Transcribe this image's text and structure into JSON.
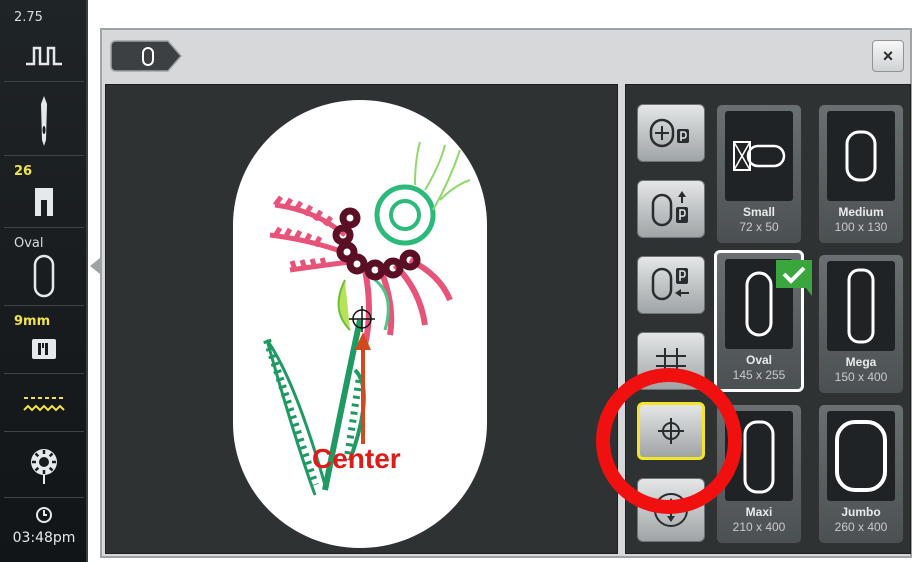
{
  "sidebar": {
    "stitch_width": "2.75",
    "thread_tension": "26",
    "hoop_label": "Oval",
    "stitch_length": "9mm",
    "clock": "03:48pm"
  },
  "top_tab": {
    "icon": "hoop-oval-icon"
  },
  "close_button": {
    "label": "×"
  },
  "tools": [
    {
      "icon": "move-to-park-icon"
    },
    {
      "icon": "move-up-park-icon"
    },
    {
      "icon": "move-left-park-icon"
    },
    {
      "icon": "grid-icon"
    },
    {
      "icon": "crosshair-center-icon"
    },
    {
      "icon": "move-vertical-icon"
    }
  ],
  "hoops": [
    {
      "name": "Small",
      "size": "72 x 50"
    },
    {
      "name": "Medium",
      "size": "100 x 130"
    },
    {
      "name": "Oval",
      "size": "145 x 255",
      "selected": true
    },
    {
      "name": "Mega",
      "size": "150 x 400"
    },
    {
      "name": "Maxi",
      "size": "210 x 400"
    },
    {
      "name": "Jumbo",
      "size": "260 x 400"
    }
  ],
  "annotation": {
    "label": "Center",
    "color": "#e01a16"
  },
  "colors": {
    "accent_yellow": "#f3e62a",
    "check_green": "#3aa63e",
    "highlight_red": "#f01010"
  }
}
